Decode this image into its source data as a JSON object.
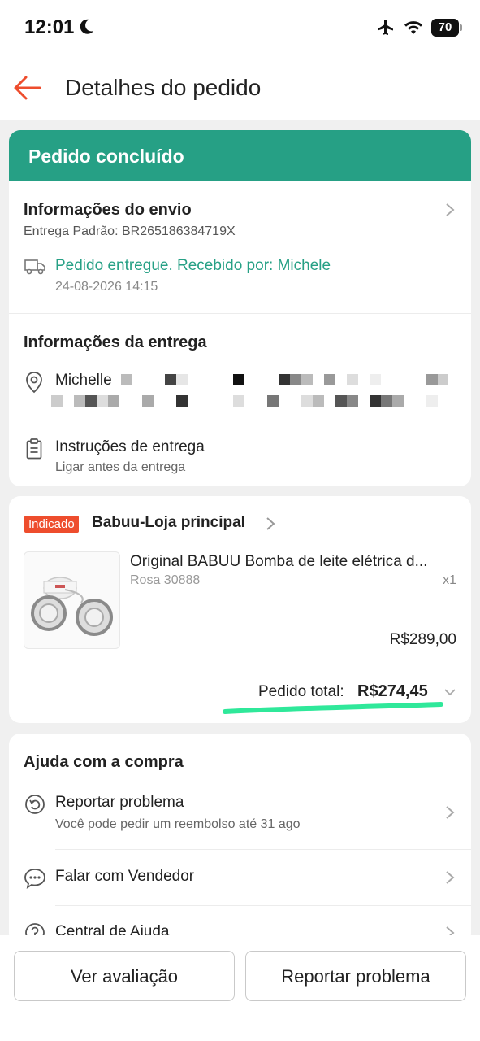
{
  "status_bar": {
    "time": "12:01",
    "battery": "70",
    "icons": [
      "moon-icon",
      "airplane-icon",
      "wifi-icon",
      "battery-icon"
    ]
  },
  "header": {
    "title": "Detalhes do pedido"
  },
  "order_status": {
    "label": "Pedido concluído"
  },
  "shipping": {
    "title": "Informações do envio",
    "method": "Entrega Padrão: BR265186384719X",
    "delivered": "Pedido entregue. Recebido por: Michele",
    "delivered_time": "24-08-2026 14:15"
  },
  "delivery": {
    "title": "Informações da entrega",
    "recipient": "Michelle",
    "instructions_title": "Instruções de entrega",
    "instructions_text": "Ligar antes da entrega"
  },
  "shop": {
    "badge": "Indicado",
    "name": "Babuu-Loja principal",
    "product": {
      "name": "Original BABUU Bomba de leite elétrica d...",
      "variant": "Rosa 30888",
      "qty": "x1",
      "price": "R$289,00"
    },
    "total_label": "Pedido total:",
    "total_value": "R$274,45"
  },
  "help": {
    "title": "Ajuda com a compra",
    "items": [
      {
        "label": "Reportar problema",
        "sub": "Você pode pedir um reembolso até 31 ago"
      },
      {
        "label": "Falar com Vendedor"
      },
      {
        "label": "Central de Ajuda"
      }
    ]
  },
  "actions": {
    "review": "Ver avaliação",
    "report": "Reportar problema"
  },
  "colors": {
    "accent": "#26a085",
    "primary": "#ee4d2d",
    "highlight": "#2fe89a"
  }
}
